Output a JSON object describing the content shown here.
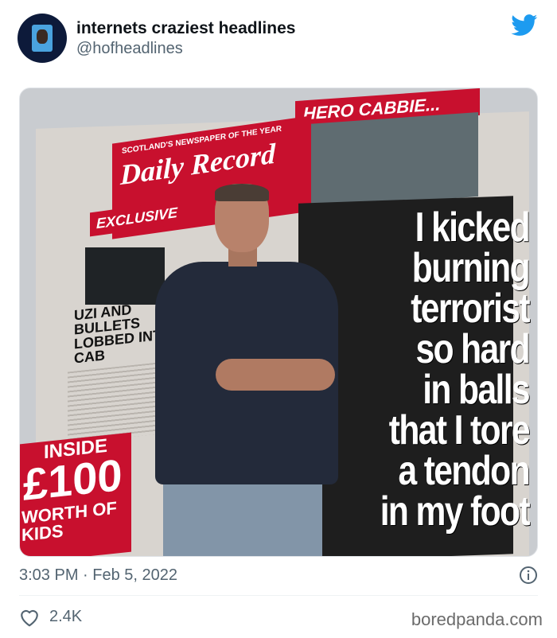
{
  "tweet": {
    "display_name": "internets craziest headlines",
    "handle": "@hofheadlines",
    "timestamp": "3:03 PM · Feb 5, 2022",
    "likes": "2.4K"
  },
  "icons": {
    "avatar": "profile-avatar",
    "platform": "twitter-bird-icon",
    "info": "info-icon",
    "like": "heart-icon"
  },
  "colors": {
    "twitter_blue": "#1d9bf0",
    "newspaper_red": "#c8102e"
  },
  "newspaper": {
    "tagline": "SCOTLAND'S NEWSPAPER OF THE YEAR",
    "masthead": "Daily Record",
    "banner": "HERO CABBIE...",
    "exclusive": "EXCLUSIVE",
    "side_story": "UZI AND BULLETS LOBBED INTO CAB",
    "inside_label": "INSIDE",
    "inside_amount": "£100",
    "inside_text": "WORTH OF KIDS",
    "headline_lines": [
      "I kicked",
      "burning",
      "terrorist",
      "so hard",
      "in balls",
      "that I tore",
      "a tendon",
      "in my foot"
    ]
  },
  "watermark": "boredpanda.com"
}
